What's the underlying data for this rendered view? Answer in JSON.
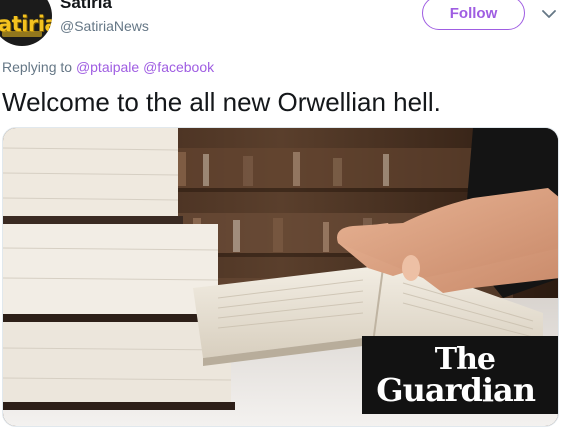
{
  "tweet": {
    "display_name": "Satiria",
    "handle": "@SatiriaNews",
    "avatar_text": "satiria",
    "follow_label": "Follow",
    "reply_prefix": "Replying to",
    "reply_mentions": [
      "@ptaipale",
      "@facebook"
    ],
    "text": "Welcome to the all new Orwellian hell."
  },
  "card": {
    "image_subject": "open book on table with stacked books and bookshelves in background",
    "logo_line1": "The",
    "logo_line2": "Guardian"
  },
  "colors": {
    "accent": "#9f5de2",
    "secondary_text": "#657786",
    "primary_text": "#14171a",
    "logo_background": "#121212"
  },
  "icons": {
    "caret": "chevron-down-icon"
  }
}
